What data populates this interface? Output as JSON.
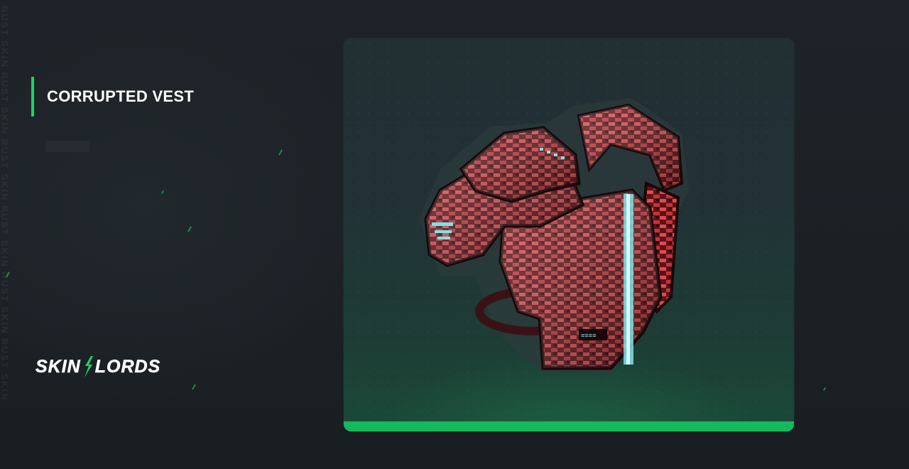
{
  "watermark": "RUST SKIN RUST SKIN RUST SKIN RUST SKIN RUST SKIN RUST SKIN",
  "item": {
    "name": "CORRUPTED VEST",
    "image_icon": "armor-vest-icon"
  },
  "brand": {
    "left": "SKIN",
    "right": "LORDS",
    "mark_icon": "lightning-slash-icon",
    "accent_color": "#1fd26a"
  },
  "colors": {
    "accent": "#1fd26a",
    "card_bar": "#14b95c",
    "background": "#1a1f23",
    "vest_red": "#b3222a",
    "vest_cyan": "#7fe3e6"
  }
}
